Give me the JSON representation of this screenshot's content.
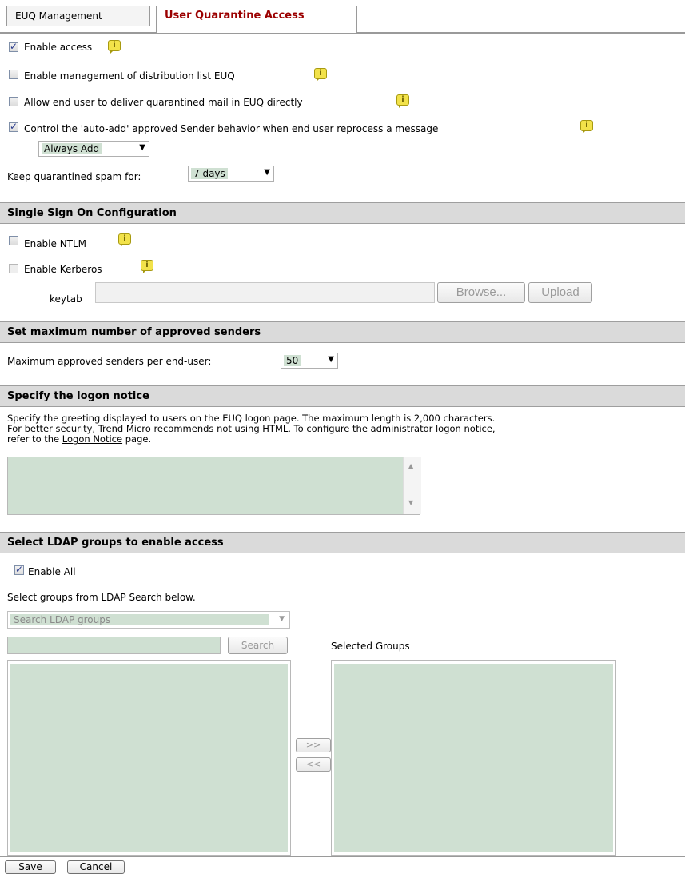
{
  "tabs": [
    "EUQ Management",
    "User Quarantine Access"
  ],
  "access": {
    "enable_access": "Enable access",
    "enable_dist_list": "Enable management of distribution list EUQ",
    "allow_deliver": "Allow end user to deliver quarantined mail in EUQ directly",
    "control_auto_add": "Control the 'auto-add' approved Sender behavior when end user reprocess a message",
    "auto_add_value": "Always Add",
    "keep_label": "Keep quarantined spam for:",
    "keep_value": "7 days",
    "checked": {
      "enable_access": true,
      "enable_dist_list": false,
      "allow_deliver": false,
      "control_auto_add": true
    }
  },
  "sso": {
    "title": "Single Sign On Configuration",
    "enable_ntlm": "Enable NTLM",
    "enable_kerberos": "Enable Kerberos",
    "keytab_label": "keytab",
    "browse": "Browse...",
    "upload": "Upload"
  },
  "max_senders": {
    "title": "Set maximum number of approved senders",
    "label": "Maximum approved senders per end-user:",
    "value": "50"
  },
  "logon": {
    "title": "Specify the logon notice",
    "desc1": "Specify the greeting displayed to users on the EUQ logon page. The maximum length is 2,000 characters.",
    "desc2": "For better security, Trend Micro recommends not using HTML. To configure the administrator logon notice,",
    "desc3_pre": "refer to the ",
    "desc3_link": "Logon Notice",
    "desc3_post": " page."
  },
  "ldap": {
    "title": "Select LDAP groups to enable access",
    "enable_all": "Enable All",
    "select_hint": "Select groups from LDAP Search below.",
    "search_placeholder": "Search LDAP groups",
    "search_button": "Search",
    "selected_groups": "Selected Groups",
    "add": ">>",
    "remove": "<<"
  },
  "footer": {
    "save": "Save",
    "cancel": "Cancel"
  },
  "colors": {
    "accent": "#9b0000",
    "field": "#cfe0d2",
    "section": "#dadada"
  }
}
